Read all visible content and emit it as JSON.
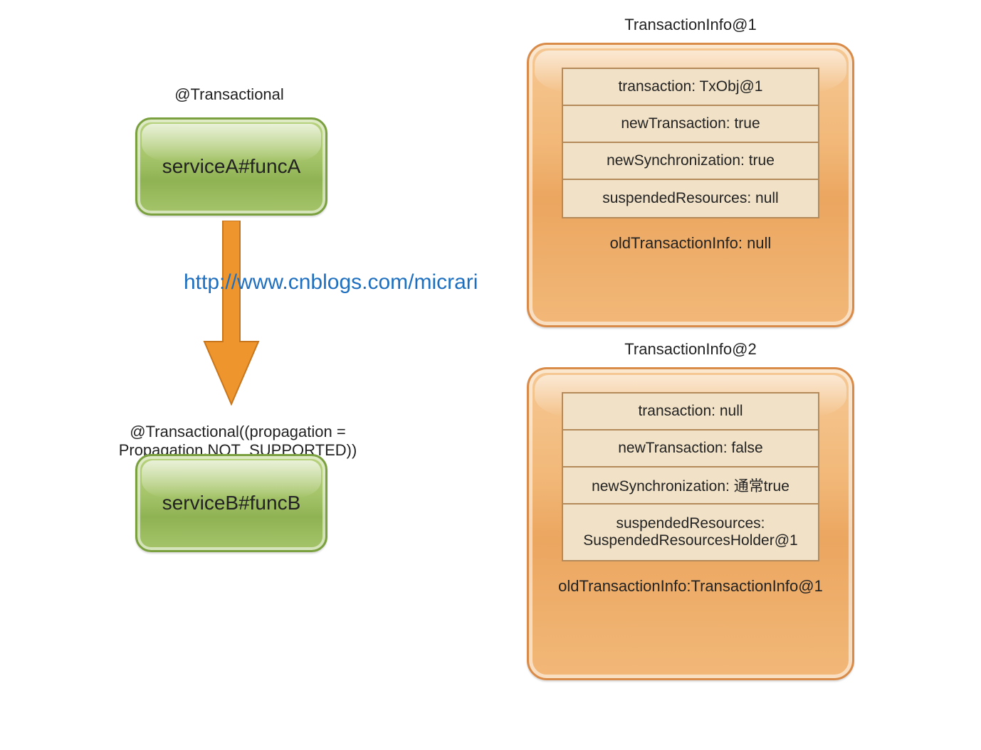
{
  "left": {
    "annoA": "@Transactional",
    "serviceA": "serviceA#funcA",
    "annoB": "@Transactional((propagation = Propagation.NOT_SUPPORTED))",
    "serviceB": "serviceB#funcB",
    "watermark": "http://www.cnblogs.com/micrari"
  },
  "panel1": {
    "title": "TransactionInfo@1",
    "rows": [
      "transaction: TxObj@1",
      "newTransaction: true",
      "newSynchronization: true",
      "suspendedResources: null"
    ],
    "footer": "oldTransactionInfo: null"
  },
  "panel2": {
    "title": "TransactionInfo@2",
    "rows": [
      "transaction: null",
      "newTransaction: false",
      "newSynchronization: 通常true",
      "suspendedResources: SuspendedResourcesHolder@1"
    ],
    "footer": "oldTransactionInfo:TransactionInfo@1"
  },
  "colors": {
    "arrow": "#ee962d",
    "link": "#1e6fbf"
  }
}
